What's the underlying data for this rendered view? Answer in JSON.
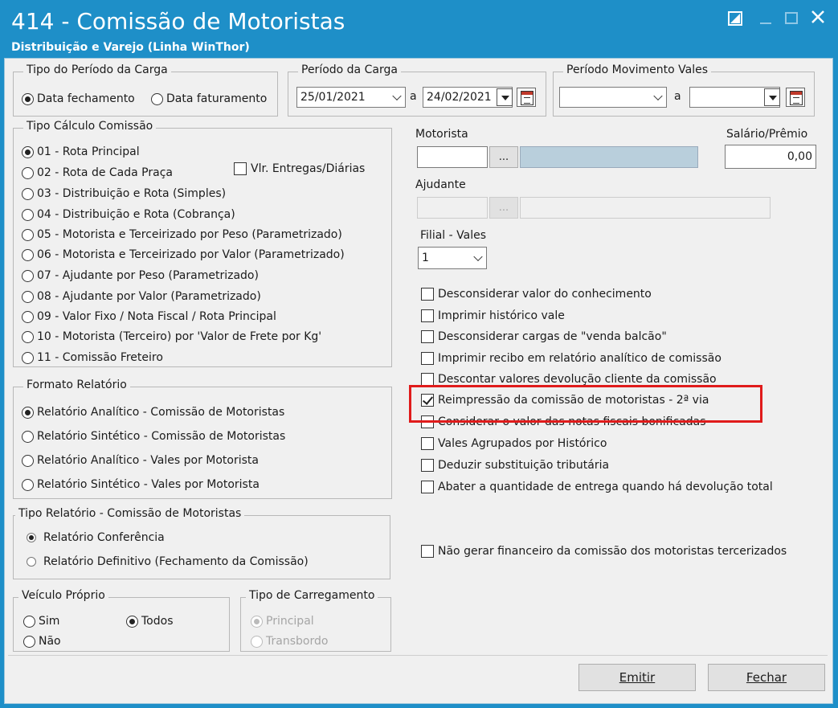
{
  "window": {
    "title": "414 - Comissão de Motoristas",
    "subtitle": "Distribuição e Varejo (Linha WinThor)"
  },
  "tipo_periodo": {
    "legend": "Tipo do Período da Carga",
    "options": [
      "Data fechamento",
      "Data faturamento"
    ],
    "selected": "Data fechamento"
  },
  "periodo_carga": {
    "legend": "Período da Carga",
    "start": "25/01/2021",
    "separator": "a",
    "end": "24/02/2021"
  },
  "periodo_vales": {
    "legend": "Período Movimento Vales",
    "start": "",
    "separator": "a",
    "end": ""
  },
  "tipo_calculo": {
    "legend": "Tipo Cálculo Comissão",
    "options": [
      "01 - Rota Principal",
      "02 - Rota de Cada Praça",
      "03 - Distribuição e Rota (Simples)",
      "04 - Distribuição e Rota (Cobrança)",
      "05 - Motorista e Terceirizado por Peso (Parametrizado)",
      "06 - Motorista e Terceirizado por Valor (Parametrizado)",
      "07 - Ajudante por Peso (Parametrizado)",
      "08 - Ajudante por Valor (Parametrizado)",
      "09 - Valor Fixo / Nota Fiscal / Rota Principal",
      "10 - Motorista (Terceiro) por 'Valor de Frete por Kg'",
      "11 - Comissão Freteiro"
    ],
    "selected": "01 - Rota Principal",
    "vlr_entregas_label": "Vlr. Entregas/Diárias"
  },
  "formato_relatorio": {
    "legend": "Formato Relatório",
    "options": [
      "Relatório Analítico - Comissão de Motoristas",
      "Relatório Sintético - Comissão de Motoristas",
      "Relatório Analítico - Vales por Motorista",
      "Relatório Sintético - Vales por Motorista"
    ],
    "selected": "Relatório Analítico - Comissão de Motoristas"
  },
  "tipo_relatorio": {
    "legend": "Tipo Relatório - Comissão de Motoristas",
    "options": [
      "Relatório Conferência",
      "Relatório Definitivo (Fechamento da Comissão)"
    ],
    "selected": "Relatório Conferência"
  },
  "veiculo_proprio": {
    "legend": "Veículo Próprio",
    "options": [
      "Sim",
      "Todos",
      "Não"
    ],
    "selected": "Todos"
  },
  "tipo_carregamento": {
    "legend": "Tipo de Carregamento",
    "options": [
      "Principal",
      "Transbordo"
    ],
    "selected": "Principal"
  },
  "motorista": {
    "label": "Motorista",
    "code": "",
    "name": "",
    "lookup_label": "..."
  },
  "salario": {
    "label": "Salário/Prêmio",
    "value": "0,00"
  },
  "ajudante": {
    "label": "Ajudante",
    "code": "",
    "name": "",
    "lookup_label": "..."
  },
  "filial_vales": {
    "label": "Filial - Vales",
    "value": "1"
  },
  "options": [
    {
      "label": "Desconsiderar valor do conhecimento",
      "checked": false
    },
    {
      "label": "Imprimir histórico vale",
      "checked": false
    },
    {
      "label": "Desconsiderar cargas de \"venda balcão\"",
      "checked": false
    },
    {
      "label": "Imprimir recibo em relatório analítico de comissão",
      "checked": false
    },
    {
      "label": "Descontar valores devolução cliente da comissão",
      "checked": false
    },
    {
      "label": "Reimpressão da comissão de motoristas  - 2ª  via",
      "checked": true
    },
    {
      "label": "Considerar o valor das notas fiscais bonificadas",
      "checked": false
    },
    {
      "label": "Vales Agrupados por Histórico",
      "checked": false
    },
    {
      "label": "Deduzir substituição tributária",
      "checked": false
    },
    {
      "label": "Abater a quantidade de entrega quando há devolução total",
      "checked": false
    }
  ],
  "nao_gerar_financeiro": {
    "label": "Não gerar financeiro da comissão dos motoristas tercerizados",
    "checked": false
  },
  "buttons": {
    "emitir": "Emitir",
    "fechar": "Fechar"
  },
  "colors": {
    "titlebar": "#1e8fc8",
    "highlight": "#e01b1b",
    "lookup_field": "#b9cfdc"
  }
}
